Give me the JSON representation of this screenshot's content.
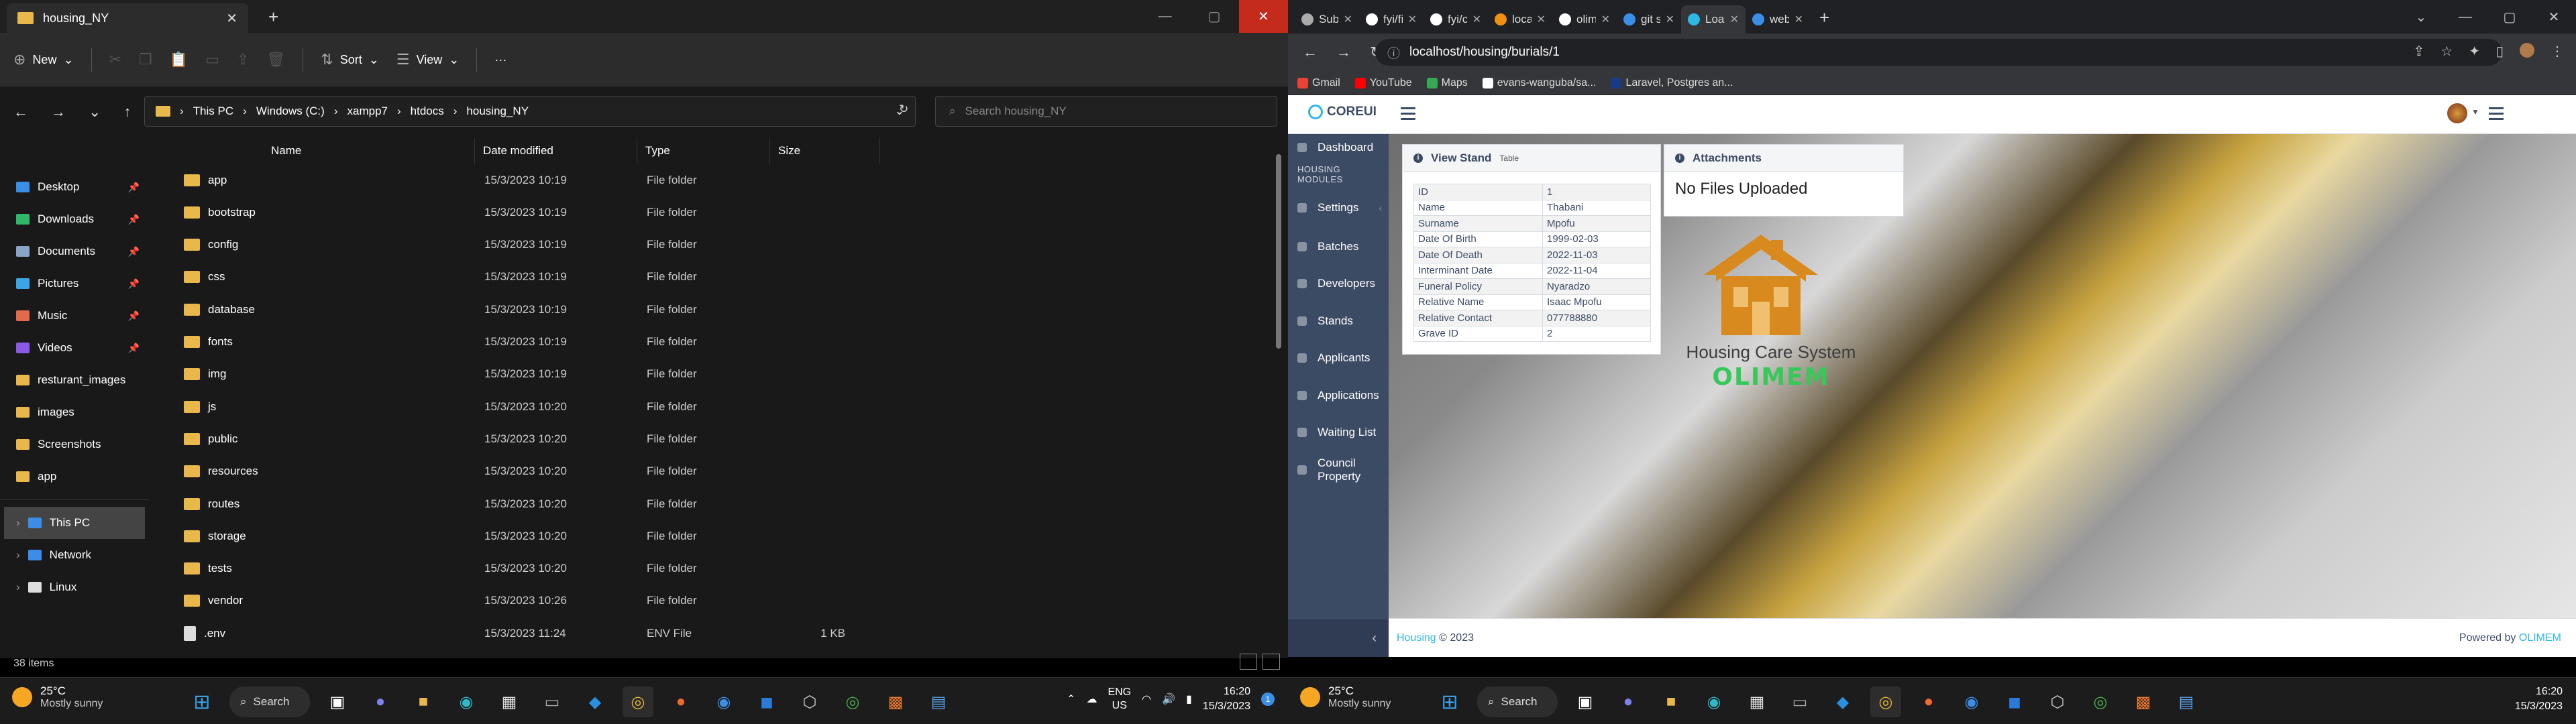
{
  "explorer": {
    "tab_title": "housing_NY",
    "toolbar": {
      "new": "New",
      "sort": "Sort",
      "view": "View",
      "more": "···"
    },
    "breadcrumb": [
      "This PC",
      "Windows (C:)",
      "xampp7",
      "htdocs",
      "housing_NY"
    ],
    "search_placeholder": "Search housing_NY",
    "nav": [
      {
        "label": "Desktop",
        "color": "#3a8ee6",
        "pinned": true
      },
      {
        "label": "Downloads",
        "color": "#2fb86a",
        "pinned": true
      },
      {
        "label": "Documents",
        "color": "#8aa4c8",
        "pinned": true
      },
      {
        "label": "Pictures",
        "color": "#3aa6e6",
        "pinned": true
      },
      {
        "label": "Music",
        "color": "#e06a4a",
        "pinned": true
      },
      {
        "label": "Videos",
        "color": "#8a5ae6",
        "pinned": true
      },
      {
        "label": "resturant_images",
        "color": "#e8b84a",
        "pinned": false
      },
      {
        "label": "images",
        "color": "#e8b84a",
        "pinned": false
      },
      {
        "label": "Screenshots",
        "color": "#e8b84a",
        "pinned": false
      },
      {
        "label": "app",
        "color": "#e8b84a",
        "pinned": false
      }
    ],
    "nav_bottom": [
      {
        "label": "This PC",
        "color": "#3a8ee6",
        "selected": true
      },
      {
        "label": "Network",
        "color": "#3a8ee6",
        "selected": false
      },
      {
        "label": "Linux",
        "color": "#ddd",
        "selected": false
      }
    ],
    "columns": {
      "name": "Name",
      "date": "Date modified",
      "type": "Type",
      "size": "Size"
    },
    "files": [
      {
        "name": "app",
        "date": "15/3/2023 10:19",
        "type": "File folder",
        "size": "",
        "kind": "folder"
      },
      {
        "name": "bootstrap",
        "date": "15/3/2023 10:19",
        "type": "File folder",
        "size": "",
        "kind": "folder"
      },
      {
        "name": "config",
        "date": "15/3/2023 10:19",
        "type": "File folder",
        "size": "",
        "kind": "folder"
      },
      {
        "name": "css",
        "date": "15/3/2023 10:19",
        "type": "File folder",
        "size": "",
        "kind": "folder"
      },
      {
        "name": "database",
        "date": "15/3/2023 10:19",
        "type": "File folder",
        "size": "",
        "kind": "folder"
      },
      {
        "name": "fonts",
        "date": "15/3/2023 10:19",
        "type": "File folder",
        "size": "",
        "kind": "folder"
      },
      {
        "name": "img",
        "date": "15/3/2023 10:19",
        "type": "File folder",
        "size": "",
        "kind": "folder"
      },
      {
        "name": "js",
        "date": "15/3/2023 10:20",
        "type": "File folder",
        "size": "",
        "kind": "folder"
      },
      {
        "name": "public",
        "date": "15/3/2023 10:20",
        "type": "File folder",
        "size": "",
        "kind": "folder"
      },
      {
        "name": "resources",
        "date": "15/3/2023 10:20",
        "type": "File folder",
        "size": "",
        "kind": "folder"
      },
      {
        "name": "routes",
        "date": "15/3/2023 10:20",
        "type": "File folder",
        "size": "",
        "kind": "folder"
      },
      {
        "name": "storage",
        "date": "15/3/2023 10:20",
        "type": "File folder",
        "size": "",
        "kind": "folder"
      },
      {
        "name": "tests",
        "date": "15/3/2023 10:20",
        "type": "File folder",
        "size": "",
        "kind": "folder"
      },
      {
        "name": "vendor",
        "date": "15/3/2023 10:26",
        "type": "File folder",
        "size": "",
        "kind": "folder"
      },
      {
        "name": ".env",
        "date": "15/3/2023 11:24",
        "type": "ENV File",
        "size": "1 KB",
        "kind": "file"
      }
    ],
    "status": "38 items"
  },
  "taskbar": {
    "temp": "25°C",
    "weather": "Mostly sunny",
    "search": "Search",
    "lang1": "ENG",
    "lang2": "US",
    "time": "16:20",
    "date": "15/3/2023",
    "badge": "1"
  },
  "chrome": {
    "tabs": [
      {
        "title": "Submitting",
        "color": "#aaaaaa",
        "active": false
      },
      {
        "title": "fyi/first-an",
        "color": "#ffffff",
        "active": false
      },
      {
        "title": "fyi/creating",
        "color": "#ffffff",
        "active": false
      },
      {
        "title": "localhost /",
        "color": "#f29111",
        "active": false
      },
      {
        "title": "olimem/ho",
        "color": "#ffffff",
        "active": false
      },
      {
        "title": "git stash - S",
        "color": "#3a8ee6",
        "active": false
      },
      {
        "title": "LoanPro",
        "color": "#2eb8e6",
        "active": true
      },
      {
        "title": "web-housin",
        "color": "#3a8ee6",
        "active": false
      }
    ],
    "url": "localhost/housing/burials/1",
    "bookmarks": [
      {
        "label": "Gmail",
        "color": "#ea4335"
      },
      {
        "label": "YouTube",
        "color": "#ff0000"
      },
      {
        "label": "Maps",
        "color": "#34a853"
      },
      {
        "label": "evans-wanguba/sa...",
        "color": "#ffffff"
      },
      {
        "label": "Laravel, Postgres an...",
        "color": "#1a3a8a"
      }
    ]
  },
  "app": {
    "logo": "COREUI",
    "sidebar": {
      "dashboard": "Dashboard",
      "section": "HOUSING MODULES",
      "items": [
        "Settings",
        "Batches",
        "Developers",
        "Stands",
        "Applicants",
        "Applications",
        "Waiting List",
        "Council Property"
      ]
    },
    "view_card": {
      "title": "View Stand",
      "subtitle": "Table",
      "rows": [
        {
          "k": "ID",
          "v": "1"
        },
        {
          "k": "Name",
          "v": "Thabani"
        },
        {
          "k": "Surname",
          "v": "Mpofu"
        },
        {
          "k": "Date Of Birth",
          "v": "1999-02-03"
        },
        {
          "k": "Date Of Death",
          "v": "2022-11-03"
        },
        {
          "k": "Interminant Date",
          "v": "2022-11-04"
        },
        {
          "k": "Funeral Policy",
          "v": "Nyaradzo"
        },
        {
          "k": "Relative Name",
          "v": "Isaac Mpofu"
        },
        {
          "k": "Relative Contact",
          "v": "077788880"
        },
        {
          "k": "Grave ID",
          "v": "2"
        }
      ]
    },
    "attach_card": {
      "title": "Attachments",
      "empty": "No Files Uploaded"
    },
    "brand_text": "Housing Care System",
    "brand_mark": "OLIMEM",
    "footer": {
      "left_link": "Housing",
      "left_text": "© 2023",
      "right_text": "Powered by",
      "right_link": "OLIMEM"
    }
  }
}
